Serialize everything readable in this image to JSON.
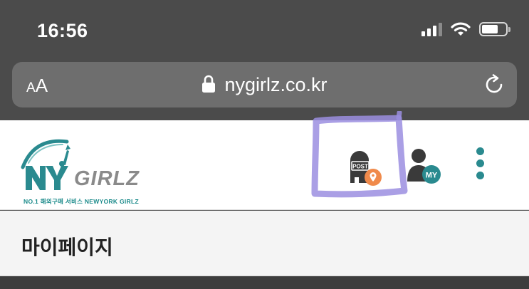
{
  "status_bar": {
    "time": "16:56"
  },
  "browser": {
    "text_size_label": "AA",
    "url": "nygirlz.co.kr"
  },
  "header": {
    "logo": {
      "text": "GIRLZ",
      "subtext": "NO.1 해외구매 서비스  NEWYORK GIRLZ"
    },
    "post_icon_label": "POST",
    "my_icon_label": "MY"
  },
  "page": {
    "title": "마이페이지"
  },
  "colors": {
    "brand_teal": "#2a8a8f",
    "accent_orange": "#f08a4b",
    "highlight_purple": "#9b8ee0"
  }
}
